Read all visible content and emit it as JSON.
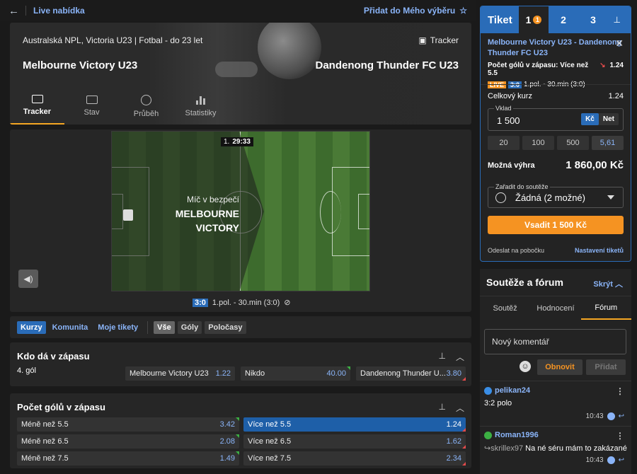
{
  "topbar": {
    "back_icon": "arrow-left-icon",
    "title": "Live nabídka",
    "favorite_label": "Přidat do Mého výběru",
    "favorite_icon": "star-outline-icon"
  },
  "match": {
    "competition": "Australská NPL, Victoria U23 | Fotbal - do 23 let",
    "tracker_label": "Tracker",
    "home_team": "Melbourne Victory U23",
    "away_team": "Dandenong Thunder FC U23",
    "tabs": [
      {
        "label": "Tracker",
        "icon": "pitch-icon",
        "active": true
      },
      {
        "label": "Stav",
        "icon": "scoreboard-icon"
      },
      {
        "label": "Průběh",
        "icon": "history-icon"
      },
      {
        "label": "Statistiky",
        "icon": "bar-chart-icon"
      }
    ]
  },
  "pitch": {
    "period": "1.",
    "clock": "29:33",
    "message_line1": "Míč v bezpečí",
    "message_line2": "MELBOURNE",
    "message_line3": "VICTORY",
    "score": "3:0",
    "status": "1.pol. - 30.min (3:0)"
  },
  "filters": {
    "groups": [
      "Kurzy",
      "Komunita",
      "Moje tikety"
    ],
    "periods": [
      "Vše",
      "Góly",
      "Poločasy"
    ]
  },
  "markets": [
    {
      "title": "Kdo dá v zápasu",
      "subtitle": "4. gól",
      "odds": [
        {
          "label": "Melbourne Victory U23",
          "value": "1.22"
        },
        {
          "label": "Nikdo",
          "value": "40.00"
        },
        {
          "label": "Dandenong Thunder U...",
          "value": "3.80"
        }
      ]
    },
    {
      "title": "Počet gólů v zápasu",
      "rows": [
        {
          "under": {
            "label": "Méně než 5.5",
            "value": "3.42"
          },
          "over": {
            "label": "Více než 5.5",
            "value": "1.24"
          }
        },
        {
          "under": {
            "label": "Méně než 6.5",
            "value": "2.08"
          },
          "over": {
            "label": "Více než 6.5",
            "value": "1.62"
          }
        },
        {
          "under": {
            "label": "Méně než 7.5",
            "value": "1.49"
          },
          "over": {
            "label": "Více než 7.5",
            "value": "2.34"
          }
        }
      ]
    }
  ],
  "ticket": {
    "title": "Tiket",
    "tabs": [
      {
        "label": "1",
        "badge": "1"
      },
      {
        "label": "2"
      },
      {
        "label": "3"
      }
    ],
    "selection_name": "Melbourne Victory U23 - Dandenong Thunder FC U23",
    "selection_bet": "Počet gólů v zápasu: Více než 5.5",
    "selection_odd": "1.24",
    "live_label": "LIVE",
    "score": "3:0",
    "status": "1.pol. - 30.min (3:0)",
    "total_odds_label": "Celkový kurz",
    "total_odds": "1.24",
    "stake_label": "Vklad",
    "stake_value": "1 500",
    "currency_on": "Kč",
    "currency_off": "Net",
    "amounts": [
      "20",
      "100",
      "500",
      "5,61"
    ],
    "win_label": "Možná výhra",
    "win_value": "1 860,00 Kč",
    "competition_label": "Zařadit do soutěže",
    "competition_value": "Žádná (2 možné)",
    "place_button": "Vsadit 1 500 Kč",
    "send_branch": "Odeslat na pobočku",
    "settings": "Nastavení tiketů"
  },
  "forum": {
    "title": "Soutěže a fórum",
    "hide_label": "Skrýt",
    "tabs": [
      "Soutěž",
      "Hodnocení",
      "Fórum"
    ],
    "placeholder": "Nový komentář",
    "refresh_label": "Obnovit",
    "post_label": "Přidat",
    "comments": [
      {
        "user": "pelikan24",
        "text": "3:2 polo",
        "time": "10:43"
      },
      {
        "user": "Roman1996",
        "reply_to": "skrillex97",
        "text": "Na né séru mám to zakázané",
        "time": "10:43"
      }
    ]
  },
  "colors": {
    "accent": "#2a6cb8",
    "orange": "#f59322",
    "link": "#8ab4f8",
    "pitch": "#4a7a36"
  }
}
